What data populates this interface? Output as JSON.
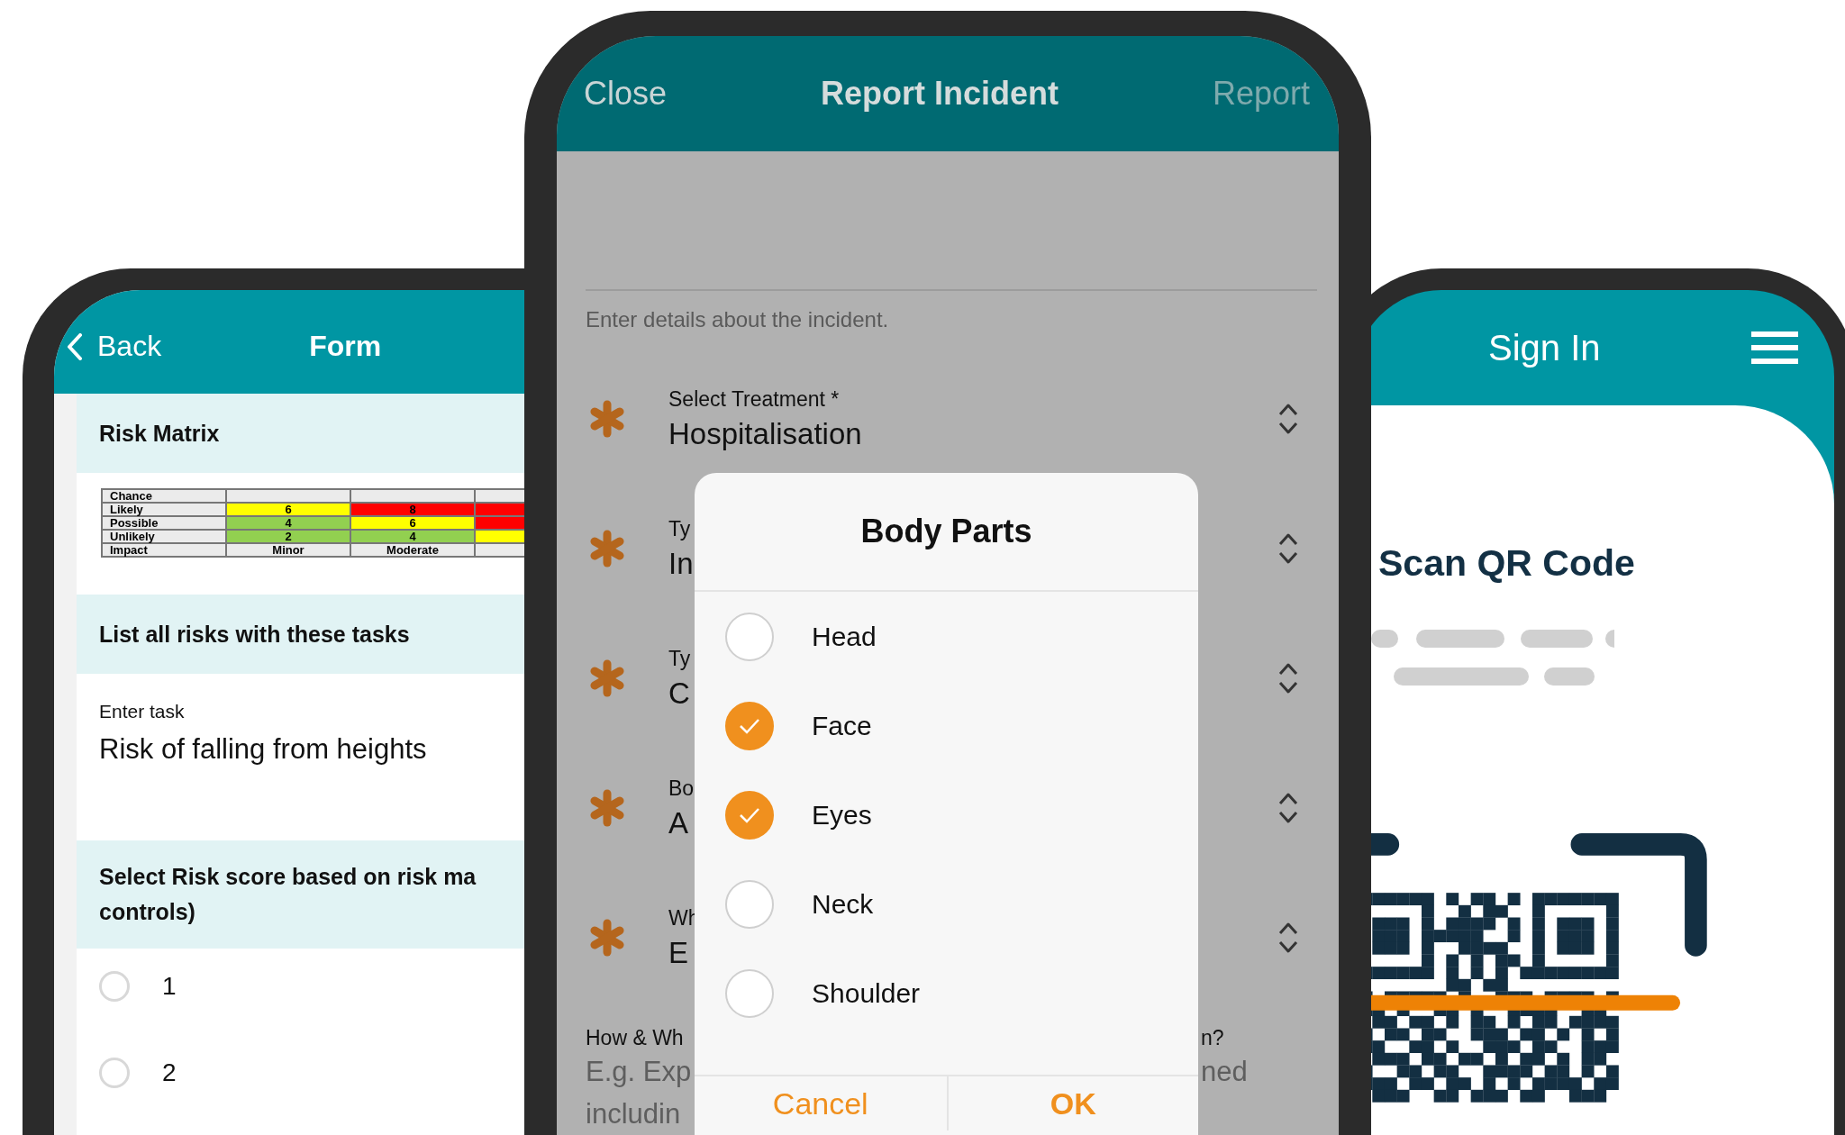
{
  "form_screen": {
    "back": "Back",
    "title": "Form",
    "sections": [
      {
        "kind": "matrix",
        "heading": "Risk Matrix",
        "rows": [
          {
            "label": "Chance",
            "cells": [
              {
                "color": "#ebebeb"
              },
              {
                "color": "#ebebeb"
              },
              {
                "color": "#ebebeb"
              }
            ]
          },
          {
            "label": "Likely",
            "cells": [
              {
                "text": "6",
                "color": "#ffff00"
              },
              {
                "text": "8",
                "color": "#ff0000"
              },
              {
                "color": "#ff0000"
              }
            ]
          },
          {
            "label": "Possible",
            "cells": [
              {
                "text": "4",
                "color": "#92d050"
              },
              {
                "text": "6",
                "color": "#ffff00"
              },
              {
                "color": "#ff0000"
              }
            ]
          },
          {
            "label": "Unlikely",
            "cells": [
              {
                "text": "2",
                "color": "#92d050"
              },
              {
                "text": "4",
                "color": "#92d050"
              },
              {
                "color": "#ffff00"
              }
            ]
          },
          {
            "label": "Impact",
            "cells": [
              {
                "text": "Minor",
                "color": "#ebebeb"
              },
              {
                "text": "Moderate",
                "color": "#ebebeb"
              },
              {
                "color": "#ebebeb"
              }
            ]
          }
        ]
      },
      {
        "kind": "text",
        "heading": "List all risks with these tasks",
        "label": "Enter task",
        "value": "Risk of falling from heights"
      },
      {
        "kind": "radio",
        "heading_lines": [
          "Select Risk score based on risk ma",
          "controls)"
        ],
        "options": [
          {
            "label": "1",
            "selected": false
          },
          {
            "label": "2",
            "selected": false
          }
        ]
      }
    ]
  },
  "incident_screen": {
    "close": "Close",
    "title": "Report Incident",
    "action": "Report",
    "intro": "Enter details about the incident.",
    "fields": [
      {
        "label": "Select Treatment *",
        "value": "Hospitalisation"
      },
      {
        "label": "Ty",
        "value": "In"
      },
      {
        "label": "Ty",
        "value": "C"
      },
      {
        "label": "Bo",
        "value": "A"
      },
      {
        "label": "Wh",
        "value": "E"
      }
    ],
    "question": {
      "left": "How & Wh",
      "right": "n?"
    },
    "hint_lines": [
      {
        "left": "E.g. Exp",
        "right": "ned"
      },
      {
        "left": "includin"
      }
    ],
    "dialog": {
      "title": "Body Parts",
      "options": [
        {
          "label": "Head",
          "checked": false
        },
        {
          "label": "Face",
          "checked": true
        },
        {
          "label": "Eyes",
          "checked": true
        },
        {
          "label": "Neck",
          "checked": false
        },
        {
          "label": "Shoulder",
          "checked": false
        }
      ],
      "cancel": "Cancel",
      "ok": "OK"
    }
  },
  "sign_in_screen": {
    "title": "Sign In",
    "heading": "Scan QR Code"
  }
}
